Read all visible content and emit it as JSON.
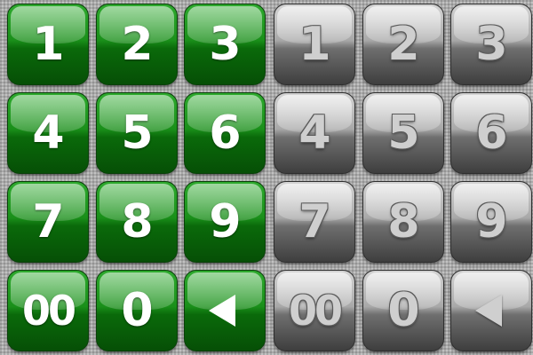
{
  "keypads": {
    "green": {
      "theme_color": "#1a8f1a",
      "keys": [
        "1",
        "2",
        "3",
        "4",
        "5",
        "6",
        "7",
        "8",
        "9",
        "00",
        "0"
      ],
      "backspace_icon": "backspace-triangle-left-icon"
    },
    "gray": {
      "theme_color": "#8a8a8a",
      "keys": [
        "1",
        "2",
        "3",
        "4",
        "5",
        "6",
        "7",
        "8",
        "9",
        "00",
        "0"
      ],
      "backspace_icon": "backspace-triangle-left-icon"
    }
  }
}
